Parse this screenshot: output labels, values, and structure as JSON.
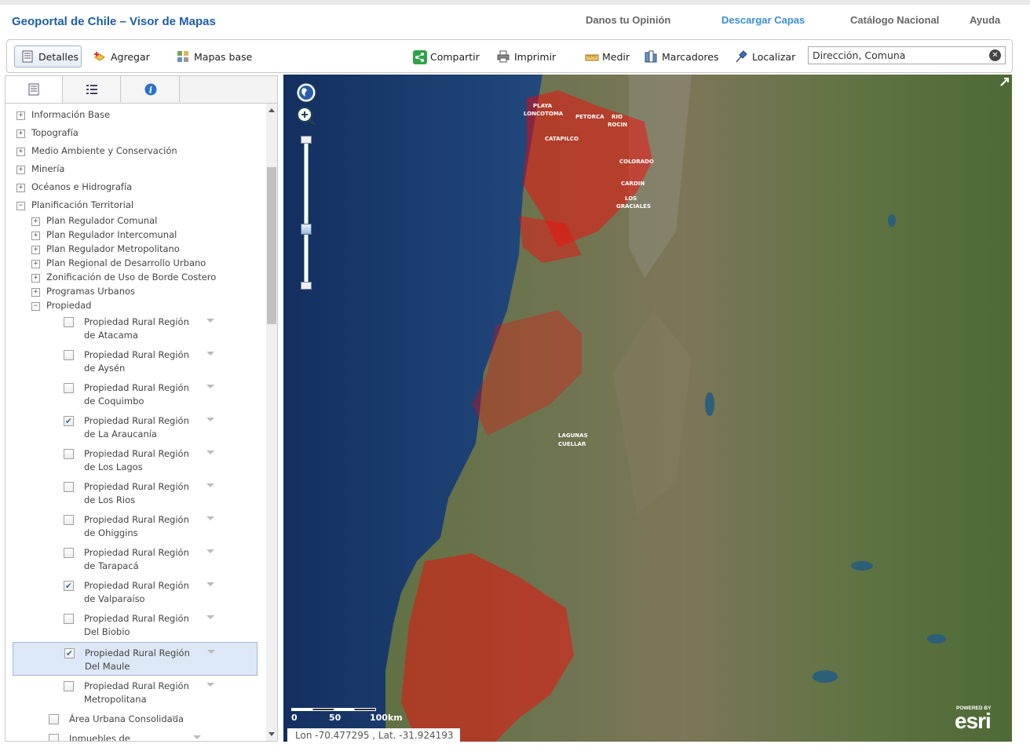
{
  "header": {
    "title": "Geoportal de Chile – Visor de Mapas",
    "nav": [
      "Danos tu Opinión",
      "Descargar Capas",
      "Catálogo Nacional",
      "Ayuda"
    ],
    "active_nav_color": "#3b8ed6",
    "title_color": "#1f5fa6"
  },
  "toolbar": {
    "detalles": "Detalles",
    "agregar": "Agregar",
    "mapas_base": "Mapas base",
    "compartir": "Compartir",
    "imprimir": "Imprimir",
    "medir": "Medir",
    "marcadores": "Marcadores",
    "localizar": "Localizar",
    "search_value": "Dirección, Comuna"
  },
  "tree": {
    "root_items": [
      "Información Base",
      "Topografía",
      "Medio Ambiente y Conservación",
      "Minería",
      "Océanos e Hidrografía",
      "Planificación Territorial"
    ],
    "sub_items": [
      "Plan Regulador Comunal",
      "Plan Regulador Intercomunal",
      "Plan Regulador Metropolitano",
      "Plan Regional de Desarrollo Urbano",
      "Zonificación de Uso de Borde Costero",
      "Programas Urbanos",
      "Propiedad"
    ],
    "layers": [
      {
        "label": "Propiedad Rural Región de Atacama",
        "checked": false
      },
      {
        "label": "Propiedad Rural Región de Aysén",
        "checked": false
      },
      {
        "label": "Propiedad Rural Región de Coquimbo",
        "checked": false
      },
      {
        "label": "Propiedad Rural Región de La Araucanía",
        "checked": true
      },
      {
        "label": "Propiedad Rural Región de Los Lagos",
        "checked": false
      },
      {
        "label": "Propiedad Rural Región de Los Rios",
        "checked": false
      },
      {
        "label": "Propiedad Rural Región de Ohiggins",
        "checked": false
      },
      {
        "label": "Propiedad Rural Región de Tarapacá",
        "checked": false
      },
      {
        "label": "Propiedad Rural Región de Valparaíso",
        "checked": true
      },
      {
        "label": "Propiedad Rural Región Del Biobio",
        "checked": false
      },
      {
        "label": "Propiedad Rural Región Del Maule",
        "checked": true
      },
      {
        "label": "Propiedad Rural Región Metropolitana",
        "checked": false
      }
    ],
    "extra_layers": [
      "Área Urbana Consolidada",
      "Inmuebles de Conservación"
    ]
  },
  "map": {
    "coords_text": "Lon -70.477295 , Lat. -31.924193",
    "scale_labels": [
      "0",
      "50",
      "100km"
    ],
    "powered_by": "POWERED BY",
    "esri": "esri",
    "place_labels": [
      "PLAYA",
      "LONCOTOMA",
      "PETORCA",
      "RIO",
      "ROCIN",
      "CATAPILCO",
      "COLORADO",
      "CARDIN",
      "LOS",
      "GRACIALES",
      "LAGUNAS",
      "CUELLAR"
    ],
    "parcel_color": "#ff0000",
    "ocean_color": "#1b3c6e"
  }
}
